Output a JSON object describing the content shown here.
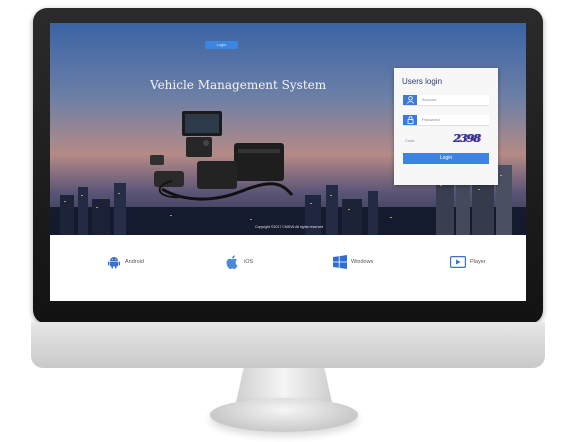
{
  "header": {
    "top_button_label": "Login"
  },
  "hero": {
    "title": "Vehicle Management System",
    "copyright": "Copyright ©2017 CMSV6 All rights reserved"
  },
  "login": {
    "title": "Users login",
    "account_placeholder": "Account",
    "password_placeholder": "Password",
    "captcha_label": "Code",
    "captcha_code": "2398",
    "button_label": "Login"
  },
  "downloads": [
    {
      "label": "Android",
      "icon": "android-icon"
    },
    {
      "label": "iOS",
      "icon": "apple-icon"
    },
    {
      "label": "Windows",
      "icon": "windows-icon"
    },
    {
      "label": "Player",
      "icon": "player-icon"
    }
  ],
  "colors": {
    "accent": "#3d84e2",
    "android": "#3b73cc",
    "apple": "#4a8ad8",
    "windows": "#2f6fd1",
    "player": "#3b73cc"
  }
}
